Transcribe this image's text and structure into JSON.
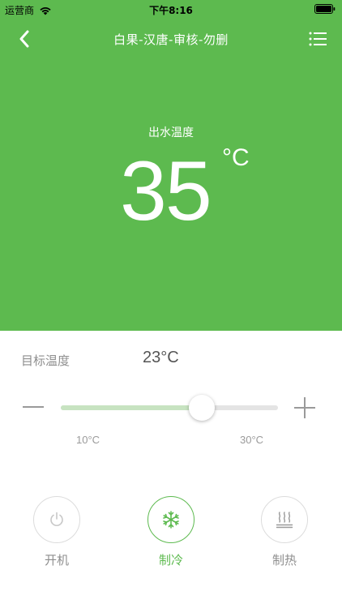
{
  "status_bar": {
    "carrier": "运营商",
    "time": "下午8:16"
  },
  "nav": {
    "title": "白果-汉唐-审核-勿删"
  },
  "outlet": {
    "label": "出水温度",
    "value": "35",
    "unit": "°C"
  },
  "target": {
    "label": "目标温度",
    "value": "23°C"
  },
  "slider": {
    "min_label": "10°C",
    "max_label": "30°C",
    "min": 10,
    "max": 30,
    "current": 23
  },
  "modes": [
    {
      "label": "开机",
      "icon": "power-icon",
      "active": false
    },
    {
      "label": "制冷",
      "icon": "snowflake-icon",
      "active": true
    },
    {
      "label": "制热",
      "icon": "heat-icon",
      "active": false
    }
  ],
  "colors": {
    "accent": "#5dba4f",
    "inactive": "#8e8e8e",
    "slider_fill": "#c7e3c1"
  }
}
